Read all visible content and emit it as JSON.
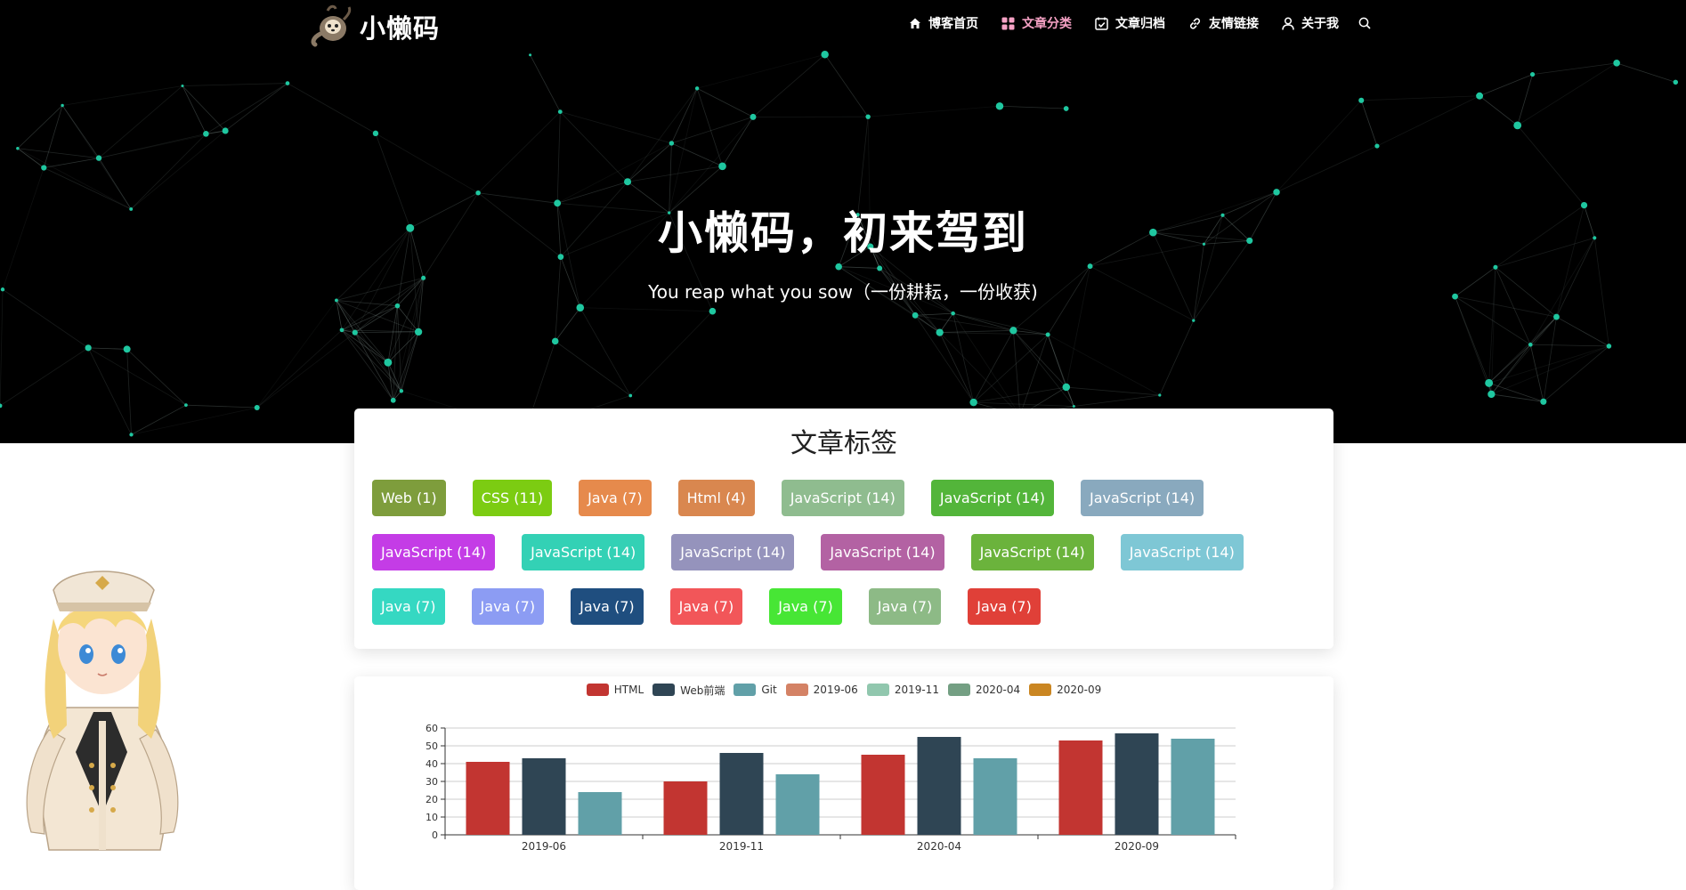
{
  "site": {
    "logo_text": "小懒码"
  },
  "nav": {
    "items": [
      {
        "label": "博客首页",
        "icon": "home-icon"
      },
      {
        "label": "文章分类",
        "icon": "grid-icon",
        "active": true
      },
      {
        "label": "文章归档",
        "icon": "calendar-check-icon"
      },
      {
        "label": "友情链接",
        "icon": "link-icon"
      },
      {
        "label": "关于我",
        "icon": "user-icon"
      }
    ],
    "search_icon": "search-icon"
  },
  "hero": {
    "title": "小懒码，初来驾到",
    "subtitle": "You reap what you sow（一份耕耘，一份收获)"
  },
  "tags_section": {
    "title": "文章标签",
    "tags": [
      {
        "label": "Web (1)",
        "color": "#7e9d3c"
      },
      {
        "label": "CSS (11)",
        "color": "#7ccc12"
      },
      {
        "label": "Java (7)",
        "color": "#e68a4c"
      },
      {
        "label": "Html (4)",
        "color": "#d9874f"
      },
      {
        "label": "JavaScript (14)",
        "color": "#8fbc8f"
      },
      {
        "label": "JavaScript (14)",
        "color": "#53b53a"
      },
      {
        "label": "JavaScript (14)",
        "color": "#89a9be"
      },
      {
        "label": "JavaScript (14)",
        "color": "#c43ce6"
      },
      {
        "label": "JavaScript (14)",
        "color": "#33d1b5"
      },
      {
        "label": "JavaScript (14)",
        "color": "#9593bc"
      },
      {
        "label": "JavaScript (14)",
        "color": "#b362a3"
      },
      {
        "label": "JavaScript (14)",
        "color": "#6bb33c"
      },
      {
        "label": "JavaScript (14)",
        "color": "#7ec7d5"
      },
      {
        "label": "Java (7)",
        "color": "#35d8c2"
      },
      {
        "label": "Java (7)",
        "color": "#8c9cf3"
      },
      {
        "label": "Java (7)",
        "color": "#1f4e7f"
      },
      {
        "label": "Java (7)",
        "color": "#f25659"
      },
      {
        "label": "Java (7)",
        "color": "#47e635"
      },
      {
        "label": "Java (7)",
        "color": "#8dba86"
      },
      {
        "label": "Java (7)",
        "color": "#e04038"
      }
    ]
  },
  "chart_data": {
    "type": "bar",
    "legend": [
      {
        "name": "HTML",
        "color": "#c23531"
      },
      {
        "name": "Web前端",
        "color": "#2f4554"
      },
      {
        "name": "Git",
        "color": "#61a0a8"
      },
      {
        "name": "2019-06",
        "color": "#d48265"
      },
      {
        "name": "2019-11",
        "color": "#91c7ae"
      },
      {
        "name": "2020-04",
        "color": "#749f83"
      },
      {
        "name": "2020-09",
        "color": "#ca8622"
      }
    ],
    "categories": [
      "2019-06",
      "2019-11",
      "2020-04",
      "2020-09"
    ],
    "series": [
      {
        "name": "HTML",
        "color": "#c23531",
        "values": [
          41,
          30,
          45,
          53
        ]
      },
      {
        "name": "Web前端",
        "color": "#2f4554",
        "values": [
          43,
          46,
          55,
          57
        ]
      },
      {
        "name": "Git",
        "color": "#61a0a8",
        "values": [
          24,
          34,
          43,
          54
        ]
      }
    ],
    "yticks": [
      0,
      10,
      20,
      30,
      40,
      50,
      60
    ],
    "ylim": [
      0,
      60
    ],
    "grid": true,
    "legend_position": "top-center"
  }
}
